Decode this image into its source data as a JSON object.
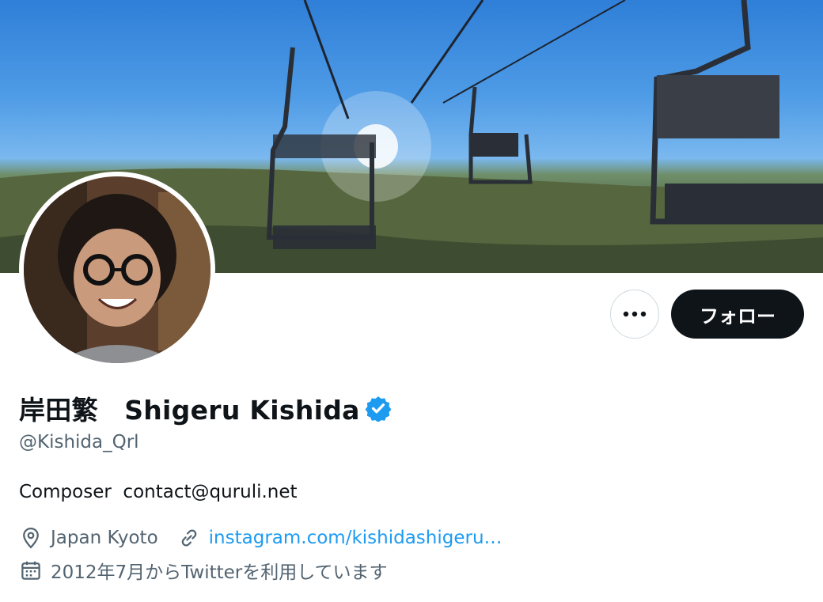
{
  "profile": {
    "display_name": "岸田繁　Shigeru Kishida",
    "handle": "@Kishida_Qrl",
    "bio": "Composer  contact@quruli.net",
    "location": "Japan Kyoto",
    "website": "instagram.com/kishidashigeru…",
    "joined": "2012年7月からTwitterを利用しています",
    "verified": true
  },
  "actions": {
    "follow_label": "フォロー",
    "more_icon": "more-horizontal-icon"
  },
  "colors": {
    "accent": "#1d9bf0",
    "text_primary": "#0f1419",
    "text_secondary": "#536471",
    "button_dark": "#0f1419",
    "border": "#cfd9de"
  }
}
